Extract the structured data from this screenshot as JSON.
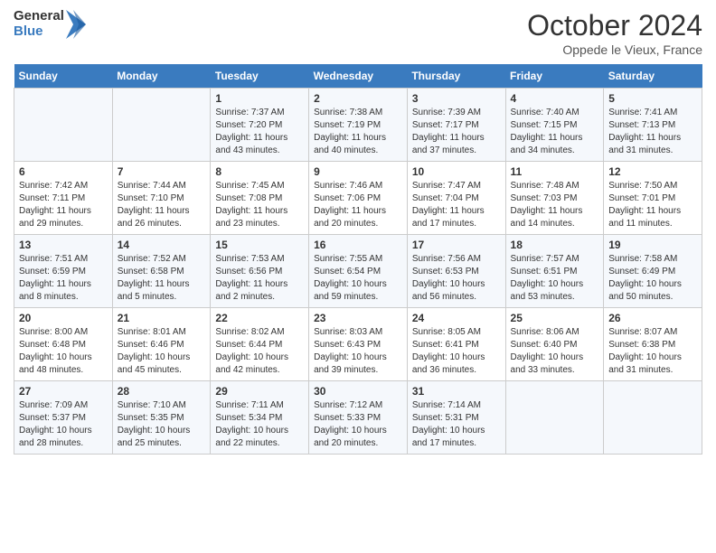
{
  "header": {
    "logo_line1": "General",
    "logo_line2": "Blue",
    "month": "October 2024",
    "location": "Oppede le Vieux, France"
  },
  "days_of_week": [
    "Sunday",
    "Monday",
    "Tuesday",
    "Wednesday",
    "Thursday",
    "Friday",
    "Saturday"
  ],
  "weeks": [
    [
      {
        "day": "",
        "sunrise": "",
        "sunset": "",
        "daylight": ""
      },
      {
        "day": "",
        "sunrise": "",
        "sunset": "",
        "daylight": ""
      },
      {
        "day": "1",
        "sunrise": "Sunrise: 7:37 AM",
        "sunset": "Sunset: 7:20 PM",
        "daylight": "Daylight: 11 hours and 43 minutes."
      },
      {
        "day": "2",
        "sunrise": "Sunrise: 7:38 AM",
        "sunset": "Sunset: 7:19 PM",
        "daylight": "Daylight: 11 hours and 40 minutes."
      },
      {
        "day": "3",
        "sunrise": "Sunrise: 7:39 AM",
        "sunset": "Sunset: 7:17 PM",
        "daylight": "Daylight: 11 hours and 37 minutes."
      },
      {
        "day": "4",
        "sunrise": "Sunrise: 7:40 AM",
        "sunset": "Sunset: 7:15 PM",
        "daylight": "Daylight: 11 hours and 34 minutes."
      },
      {
        "day": "5",
        "sunrise": "Sunrise: 7:41 AM",
        "sunset": "Sunset: 7:13 PM",
        "daylight": "Daylight: 11 hours and 31 minutes."
      }
    ],
    [
      {
        "day": "6",
        "sunrise": "Sunrise: 7:42 AM",
        "sunset": "Sunset: 7:11 PM",
        "daylight": "Daylight: 11 hours and 29 minutes."
      },
      {
        "day": "7",
        "sunrise": "Sunrise: 7:44 AM",
        "sunset": "Sunset: 7:10 PM",
        "daylight": "Daylight: 11 hours and 26 minutes."
      },
      {
        "day": "8",
        "sunrise": "Sunrise: 7:45 AM",
        "sunset": "Sunset: 7:08 PM",
        "daylight": "Daylight: 11 hours and 23 minutes."
      },
      {
        "day": "9",
        "sunrise": "Sunrise: 7:46 AM",
        "sunset": "Sunset: 7:06 PM",
        "daylight": "Daylight: 11 hours and 20 minutes."
      },
      {
        "day": "10",
        "sunrise": "Sunrise: 7:47 AM",
        "sunset": "Sunset: 7:04 PM",
        "daylight": "Daylight: 11 hours and 17 minutes."
      },
      {
        "day": "11",
        "sunrise": "Sunrise: 7:48 AM",
        "sunset": "Sunset: 7:03 PM",
        "daylight": "Daylight: 11 hours and 14 minutes."
      },
      {
        "day": "12",
        "sunrise": "Sunrise: 7:50 AM",
        "sunset": "Sunset: 7:01 PM",
        "daylight": "Daylight: 11 hours and 11 minutes."
      }
    ],
    [
      {
        "day": "13",
        "sunrise": "Sunrise: 7:51 AM",
        "sunset": "Sunset: 6:59 PM",
        "daylight": "Daylight: 11 hours and 8 minutes."
      },
      {
        "day": "14",
        "sunrise": "Sunrise: 7:52 AM",
        "sunset": "Sunset: 6:58 PM",
        "daylight": "Daylight: 11 hours and 5 minutes."
      },
      {
        "day": "15",
        "sunrise": "Sunrise: 7:53 AM",
        "sunset": "Sunset: 6:56 PM",
        "daylight": "Daylight: 11 hours and 2 minutes."
      },
      {
        "day": "16",
        "sunrise": "Sunrise: 7:55 AM",
        "sunset": "Sunset: 6:54 PM",
        "daylight": "Daylight: 10 hours and 59 minutes."
      },
      {
        "day": "17",
        "sunrise": "Sunrise: 7:56 AM",
        "sunset": "Sunset: 6:53 PM",
        "daylight": "Daylight: 10 hours and 56 minutes."
      },
      {
        "day": "18",
        "sunrise": "Sunrise: 7:57 AM",
        "sunset": "Sunset: 6:51 PM",
        "daylight": "Daylight: 10 hours and 53 minutes."
      },
      {
        "day": "19",
        "sunrise": "Sunrise: 7:58 AM",
        "sunset": "Sunset: 6:49 PM",
        "daylight": "Daylight: 10 hours and 50 minutes."
      }
    ],
    [
      {
        "day": "20",
        "sunrise": "Sunrise: 8:00 AM",
        "sunset": "Sunset: 6:48 PM",
        "daylight": "Daylight: 10 hours and 48 minutes."
      },
      {
        "day": "21",
        "sunrise": "Sunrise: 8:01 AM",
        "sunset": "Sunset: 6:46 PM",
        "daylight": "Daylight: 10 hours and 45 minutes."
      },
      {
        "day": "22",
        "sunrise": "Sunrise: 8:02 AM",
        "sunset": "Sunset: 6:44 PM",
        "daylight": "Daylight: 10 hours and 42 minutes."
      },
      {
        "day": "23",
        "sunrise": "Sunrise: 8:03 AM",
        "sunset": "Sunset: 6:43 PM",
        "daylight": "Daylight: 10 hours and 39 minutes."
      },
      {
        "day": "24",
        "sunrise": "Sunrise: 8:05 AM",
        "sunset": "Sunset: 6:41 PM",
        "daylight": "Daylight: 10 hours and 36 minutes."
      },
      {
        "day": "25",
        "sunrise": "Sunrise: 8:06 AM",
        "sunset": "Sunset: 6:40 PM",
        "daylight": "Daylight: 10 hours and 33 minutes."
      },
      {
        "day": "26",
        "sunrise": "Sunrise: 8:07 AM",
        "sunset": "Sunset: 6:38 PM",
        "daylight": "Daylight: 10 hours and 31 minutes."
      }
    ],
    [
      {
        "day": "27",
        "sunrise": "Sunrise: 7:09 AM",
        "sunset": "Sunset: 5:37 PM",
        "daylight": "Daylight: 10 hours and 28 minutes."
      },
      {
        "day": "28",
        "sunrise": "Sunrise: 7:10 AM",
        "sunset": "Sunset: 5:35 PM",
        "daylight": "Daylight: 10 hours and 25 minutes."
      },
      {
        "day": "29",
        "sunrise": "Sunrise: 7:11 AM",
        "sunset": "Sunset: 5:34 PM",
        "daylight": "Daylight: 10 hours and 22 minutes."
      },
      {
        "day": "30",
        "sunrise": "Sunrise: 7:12 AM",
        "sunset": "Sunset: 5:33 PM",
        "daylight": "Daylight: 10 hours and 20 minutes."
      },
      {
        "day": "31",
        "sunrise": "Sunrise: 7:14 AM",
        "sunset": "Sunset: 5:31 PM",
        "daylight": "Daylight: 10 hours and 17 minutes."
      },
      {
        "day": "",
        "sunrise": "",
        "sunset": "",
        "daylight": ""
      },
      {
        "day": "",
        "sunrise": "",
        "sunset": "",
        "daylight": ""
      }
    ]
  ]
}
